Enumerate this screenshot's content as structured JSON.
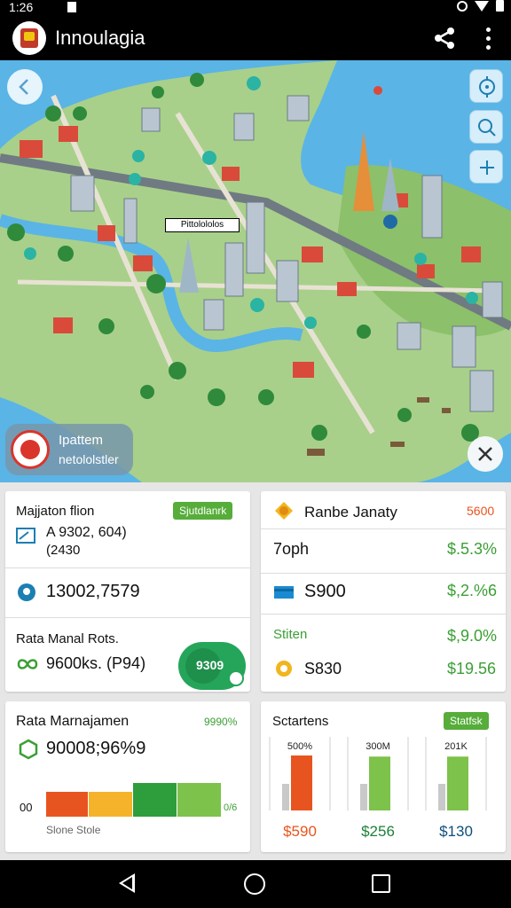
{
  "status_bar": {
    "time": "1:26"
  },
  "app_bar": {
    "title": "Innoulagia"
  },
  "map": {
    "label": "Pittolololos",
    "legend_line1": "Ipattem",
    "legend_line2": "netololstler"
  },
  "card1": {
    "title": "Majjaton flion",
    "badge": "Sjutdlanrk",
    "value_main": "A 9302, 604)",
    "value_sub": "(2430",
    "row2_value": "13002,7579",
    "row3_title": "Rata Manal Rots.",
    "row3_value": "9600ks. (P94)",
    "pill_text": "9309"
  },
  "card2": {
    "title": "Ranbe Janaty",
    "title_value": "5600",
    "row1_label": "7oph",
    "row1_value": "$.5.3%",
    "row2_label": "S900",
    "row2_value": "$,2.%6",
    "row3_label": "Stiten",
    "row3_value": "$,9.0%",
    "row4_label": "S830",
    "row4_value": "$19.56"
  },
  "card3": {
    "title": "Rata Marnajamen",
    "title_value": "9990%",
    "value": "90008;96%9",
    "axis_start": "00",
    "axis_end": "0/6",
    "footer": "Slone Stole",
    "segment_colors": [
      "#e8541f",
      "#f5b32b",
      "#2e9e3c",
      "#7dc24a"
    ]
  },
  "card4": {
    "title": "Sctartens",
    "badge": "Statfsk",
    "bars": [
      {
        "label": "500%",
        "value": "$590",
        "value_color": "#e8541f",
        "fill": 1.0,
        "color": "#e8541f"
      },
      {
        "label": "300M",
        "value": "$256",
        "value_color": "#1c7f3a",
        "fill": 0.98,
        "color": "#7dc24a"
      },
      {
        "label": "201K",
        "value": "$130",
        "value_color": "#0e4f7a",
        "fill": 0.98,
        "color": "#7dc24a"
      }
    ]
  },
  "colors": {
    "accent_green": "#56ad3a",
    "map_water": "#5ab4e6",
    "dash_bg": "#e6e6e6"
  }
}
